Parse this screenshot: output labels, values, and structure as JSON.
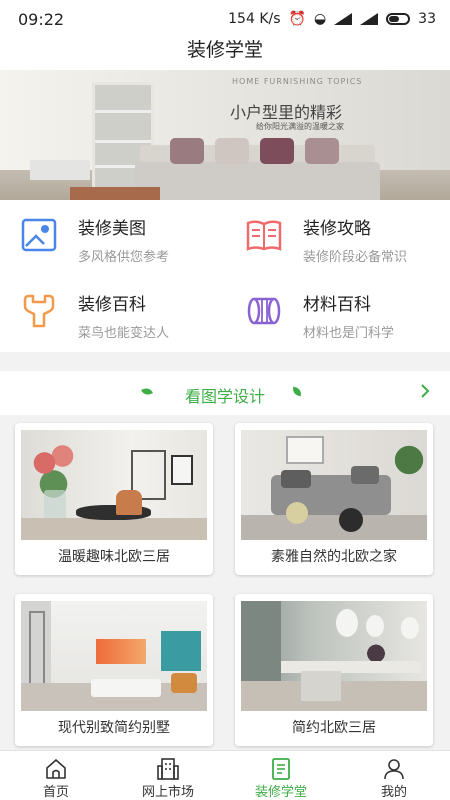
{
  "status_bar": {
    "time": "09:22",
    "speed": "154 K/s",
    "battery": "33"
  },
  "header": {
    "title": "装修学堂"
  },
  "banner": {
    "tagline_en": "HOME FURNISHING TOPICS",
    "headline": "小户型里的精彩",
    "subline": "给你阳光满溢的温暖之家"
  },
  "features": [
    {
      "name": "装修美图",
      "desc": "多风格供您参考",
      "icon": "picture-icon",
      "color": "#4a86e8"
    },
    {
      "name": "装修攻略",
      "desc": "装修阶段必备常识",
      "icon": "book-icon",
      "color": "#ef6b6b"
    },
    {
      "name": "装修百科",
      "desc": "菜鸟也能变达人",
      "icon": "wrench-icon",
      "color": "#f39a4a"
    },
    {
      "name": "材料百科",
      "desc": "材料也是门科学",
      "icon": "pipe-icon",
      "color": "#8a63d2"
    }
  ],
  "section": {
    "title": "看图学设计",
    "accent": "#3dae46"
  },
  "cards": [
    {
      "caption": "温暖趣味北欧三居"
    },
    {
      "caption": "素雅自然的北欧之家"
    },
    {
      "caption": "现代别致简约别墅"
    },
    {
      "caption": "简约北欧三居"
    }
  ],
  "tabs": [
    {
      "label": "首页",
      "icon": "home-icon"
    },
    {
      "label": "网上市场",
      "icon": "building-icon"
    },
    {
      "label": "装修学堂",
      "icon": "document-icon",
      "active": true
    },
    {
      "label": "我的",
      "icon": "person-icon"
    }
  ]
}
